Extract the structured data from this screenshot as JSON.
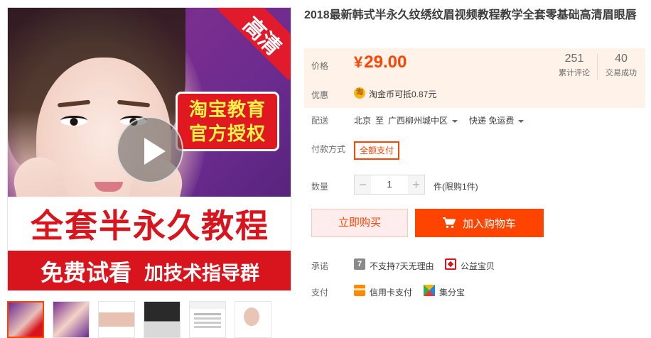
{
  "media": {
    "corner_tag": "高清",
    "auth_line1": "淘宝教育",
    "auth_line2": "官方授权",
    "banner_main": "全套半永久教程",
    "banner_sub1": "免费试看",
    "banner_sub2": "加技术指导群"
  },
  "product": {
    "title": "2018最新韩式半永久纹绣纹眉视频教程教学全套零基础高清眉眼唇"
  },
  "price": {
    "label": "价格",
    "currency": "¥",
    "amount": "29.00",
    "reviews_count": "251",
    "reviews_label": "累计评论",
    "deals_count": "40",
    "deals_label": "交易成功",
    "promo_label": "优惠",
    "coin_icon": "淘",
    "coin_text": "淘金币可抵0.87元"
  },
  "delivery": {
    "label": "配送",
    "from": "北京",
    "to_word": "至",
    "dest": "广西柳州城中区",
    "method": "快递 免运费"
  },
  "payment": {
    "label": "付款方式",
    "option": "全额支付"
  },
  "quantity": {
    "label": "数量",
    "minus": "−",
    "value": "1",
    "plus": "+",
    "unit_note": "件(限购1件)"
  },
  "actions": {
    "buy_now": "立即购买",
    "add_cart": "加入购物车"
  },
  "promise": {
    "label": "承诺",
    "seven_icon": "7",
    "item1": "不支持7天无理由",
    "item2": "公益宝贝"
  },
  "pay": {
    "label": "支付",
    "item1": "信用卡支付",
    "item2": "集分宝"
  },
  "colors": {
    "accent": "#ff4400",
    "price_bg": "#fff2e8",
    "brand_red": "#d8141d"
  }
}
